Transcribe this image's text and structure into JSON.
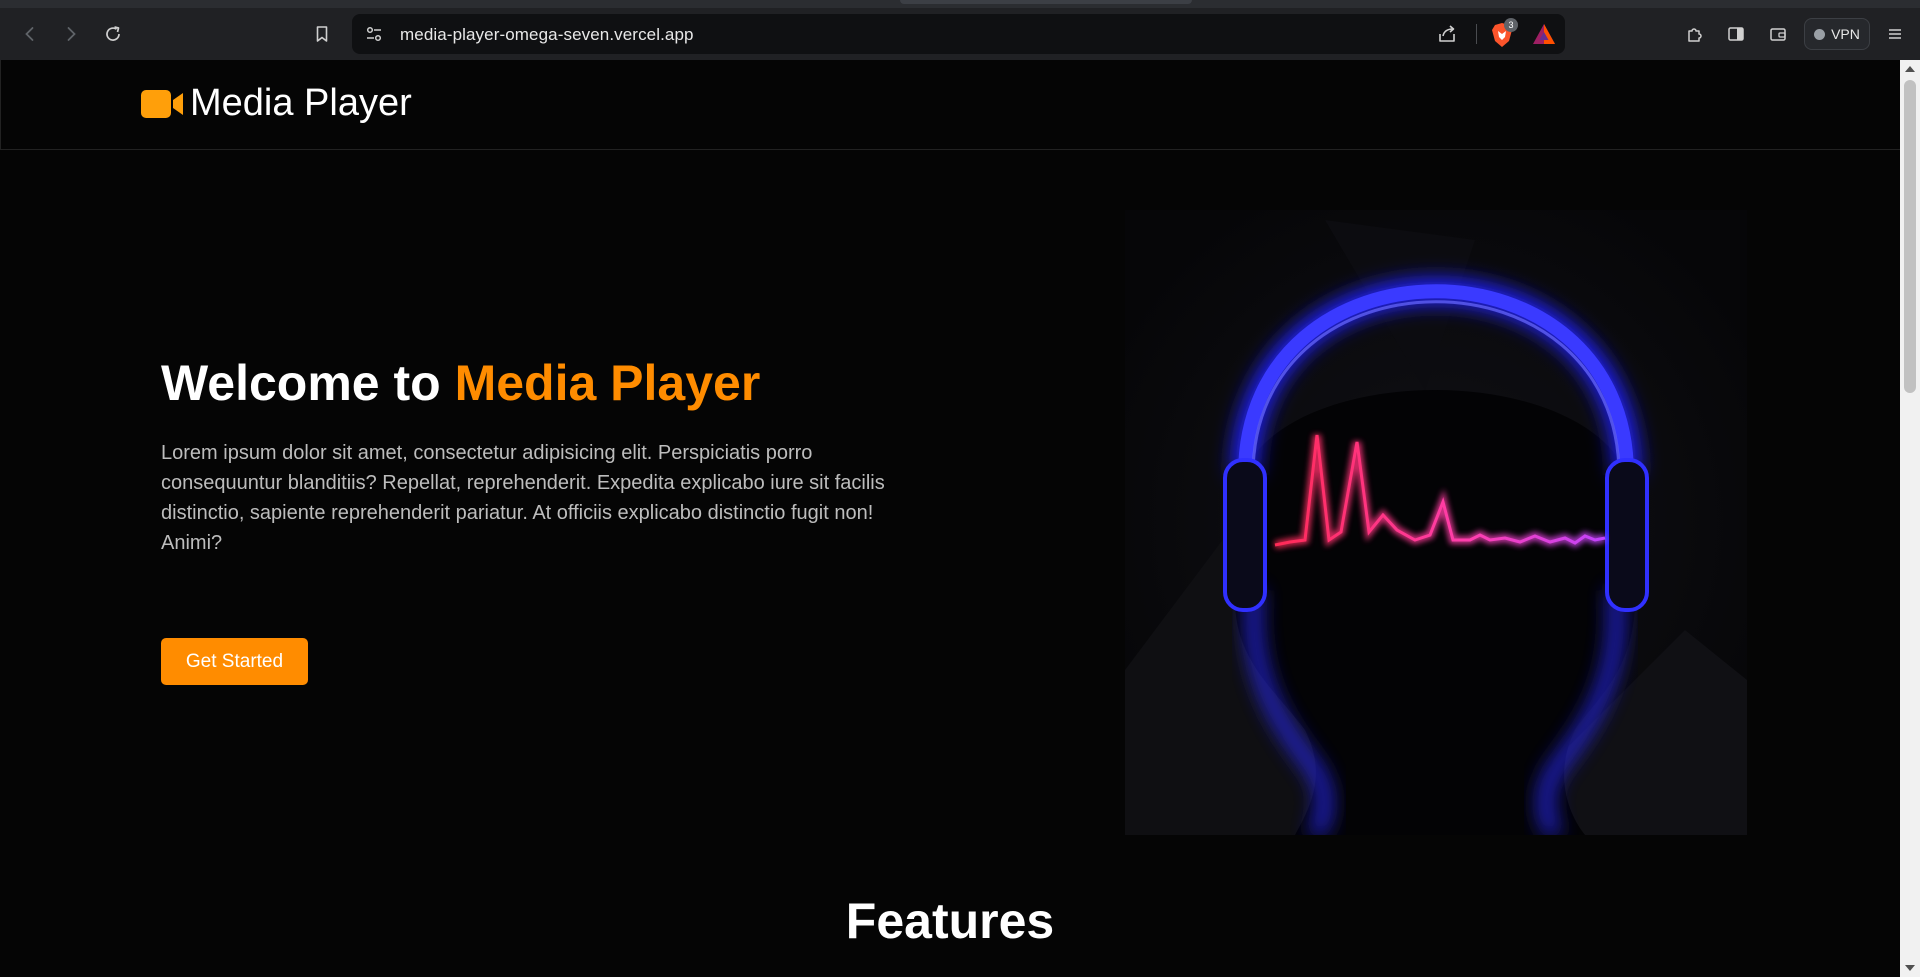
{
  "browser": {
    "url": "media-player-omega-seven.vercel.app",
    "shields_count": "3",
    "vpn_label": "VPN"
  },
  "icons": {
    "back": "back-arrow-icon",
    "forward": "forward-arrow-icon",
    "reload": "reload-icon",
    "bookmark": "bookmark-icon",
    "site_settings": "tune-icon",
    "share": "share-icon",
    "brave_shields": "brave-lion-icon",
    "rewards": "bat-triangle-icon",
    "extensions": "puzzle-icon",
    "sidebar": "sidebar-icon",
    "wallet": "wallet-icon",
    "menu": "hamburger-menu-icon",
    "logo": "video-camera-icon"
  },
  "colors": {
    "accent": "#ff8c00",
    "background": "#050505",
    "text": "#ffffff"
  },
  "navbar": {
    "brand": "Media Player"
  },
  "hero": {
    "title_prefix": "Welcome to ",
    "title_accent": "Media Player",
    "description": "Lorem ipsum dolor sit amet, consectetur adipisicing elit. Perspiciatis porro consequuntur blanditiis? Repellat, reprehenderit. Expedita explicabo iure sit facilis distinctio, sapiente reprehenderit pariatur. At officiis explicabo distinctio fugit non! Animi?",
    "cta_label": "Get Started"
  },
  "features": {
    "heading": "Features"
  }
}
